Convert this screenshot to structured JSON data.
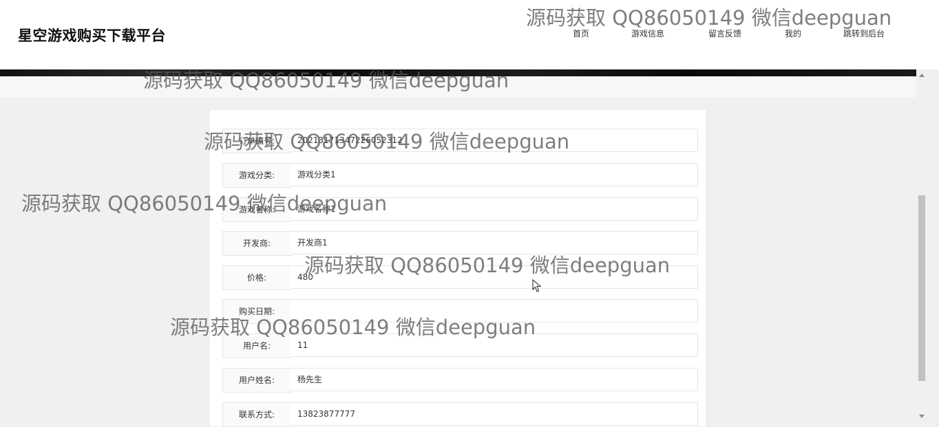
{
  "header": {
    "site_title": "星空游戏购买下载平台",
    "nav": [
      "首页",
      "游戏信息",
      "留言反馈",
      "我的",
      "跳转到后台"
    ]
  },
  "form": {
    "fields": [
      {
        "label": "订单编号:",
        "value": "20213171347226052312"
      },
      {
        "label": "游戏分类:",
        "value": "游戏分类1"
      },
      {
        "label": "游戏名称:",
        "value": "游戏名称1"
      },
      {
        "label": "开发商:",
        "value": "开发商1"
      },
      {
        "label": "价格:",
        "value": "480"
      },
      {
        "label": "购买日期:",
        "value": ""
      },
      {
        "label": "用户名:",
        "value": "11"
      },
      {
        "label": "用户姓名:",
        "value": "杨先生"
      },
      {
        "label": "联系方式:",
        "value": "13823877777"
      }
    ]
  },
  "watermark_text": "源码获取 QQ86050149 微信deepguan",
  "icons": {
    "scroll_up": "scroll-up-arrow-icon",
    "scroll_down": "scroll-down-arrow-icon",
    "cursor": "mouse-cursor-icon"
  }
}
